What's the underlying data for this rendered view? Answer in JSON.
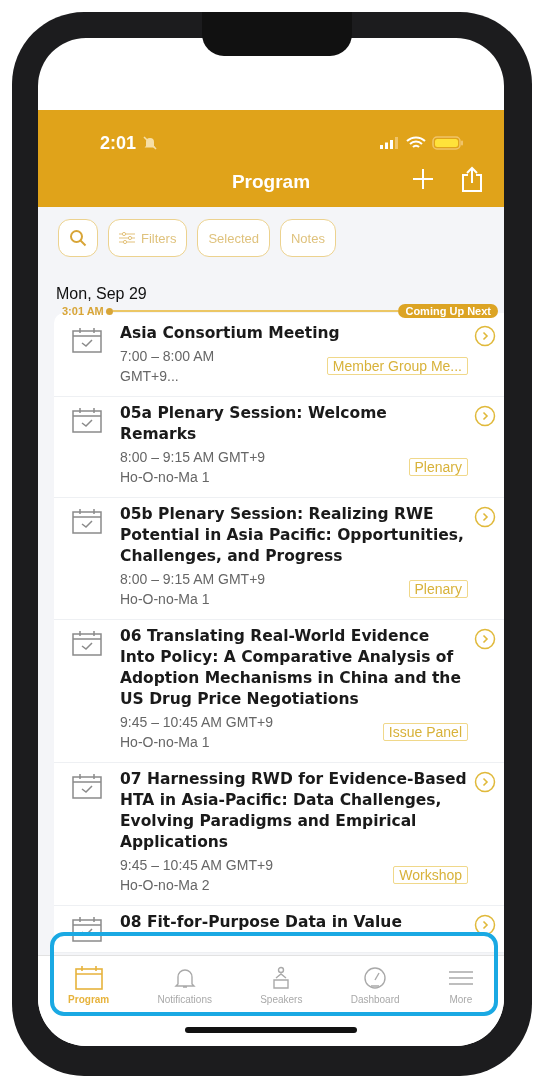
{
  "status_bar": {
    "time": "2:01"
  },
  "nav": {
    "title": "Program"
  },
  "toolbar": {
    "buttons": [
      "Filters",
      "Selected",
      "Notes"
    ]
  },
  "day": {
    "date": "Mon, Sep 29",
    "now_time": "3:01 AM",
    "next_label": "Coming Up Next"
  },
  "sessions": [
    {
      "title": "Asia Consortium Meeting",
      "time": "7:00 – 8:00 AM GMT+9...",
      "tag": "Member Group Me..."
    },
    {
      "title": "05a Plenary Session: Welcome Remarks",
      "time": "8:00 – 9:15 AM GMT+9",
      "location": "Ho-O-no-Ma 1",
      "tag": "Plenary"
    },
    {
      "title": "05b Plenary Session: Realizing RWE Potential in Asia Pacific: Opportunities, Challenges, and Progress",
      "time": "8:00 – 9:15 AM GMT+9",
      "location": "Ho-O-no-Ma 1",
      "tag": "Plenary"
    },
    {
      "title": "06 Translating Real-World Evidence Into Policy: A Comparative Analysis of Adoption Mechanisms in China and the US Drug Price Negotiations",
      "time": "9:45 – 10:45 AM GMT+9",
      "location": "Ho-O-no-Ma 1",
      "tag": "Issue Panel"
    },
    {
      "title": "07 Harnessing RWD for Evidence-Based HTA in Asia-Pacific: Data Challenges, Evolving Paradigms and Empirical Applications",
      "time": "9:45 – 10:45 AM GMT+9",
      "location": "Ho-O-no-Ma 2",
      "tag": "Workshop"
    },
    {
      "title": "08 Fit-for-Purpose Data in Value"
    }
  ],
  "tabs": [
    {
      "kind": "program",
      "label": "Program",
      "selected": true
    },
    {
      "kind": "notifications",
      "label": "Notifications",
      "selected": false
    },
    {
      "kind": "speakers",
      "label": "Speakers",
      "selected": false
    },
    {
      "kind": "dashboard",
      "label": "Dashboard",
      "selected": false
    },
    {
      "kind": "more",
      "label": "More",
      "selected": false
    }
  ]
}
